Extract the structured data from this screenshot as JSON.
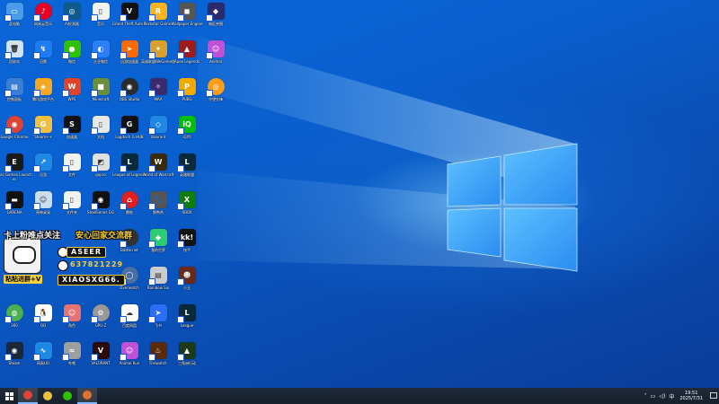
{
  "desktop": {
    "icons": [
      {
        "label": "此电脑",
        "bg": "#4a9bea",
        "glyph": "▭",
        "col": 0,
        "row": 0
      },
      {
        "label": "网易云音乐",
        "bg": "#e60026",
        "glyph": "♪",
        "col": 1,
        "row": 0,
        "round": true
      },
      {
        "label": "Ai检测器",
        "bg": "#0e5a8a",
        "glyph": "◎",
        "col": 2,
        "row": 0
      },
      {
        "label": "音乐",
        "bg": "#f2f2f2",
        "glyph": "▯",
        "col": 3,
        "row": 0
      },
      {
        "label": "Grand Theft Auto V",
        "bg": "#111",
        "glyph": "V",
        "col": 4,
        "row": 0
      },
      {
        "label": "Rockstar Games",
        "bg": "#f9b31c",
        "glyph": "R",
        "col": 5,
        "row": 0
      },
      {
        "label": "Wallpaper Engine",
        "bg": "#555",
        "glyph": "◼",
        "col": 6,
        "row": 0
      },
      {
        "label": "暗区突围",
        "bg": "#2b2a6e",
        "glyph": "◆",
        "col": 7,
        "row": 0
      },
      {
        "label": "回收站",
        "bg": "#cfe3f5",
        "glyph": "🗑",
        "col": 0,
        "row": 1
      },
      {
        "label": "迅雷",
        "bg": "#1d7cf2",
        "glyph": "↯",
        "col": 1,
        "row": 1
      },
      {
        "label": "微信",
        "bg": "#2dc100",
        "glyph": "●",
        "col": 2,
        "row": 1
      },
      {
        "label": "企业微信",
        "bg": "#2d7ff9",
        "glyph": "◐",
        "col": 3,
        "row": 1
      },
      {
        "label": "迅游加速器",
        "bg": "#ff6a00",
        "glyph": "➤",
        "col": 4,
        "row": 1
      },
      {
        "label": "英雄联盟WeGame版",
        "bg": "#d9a12b",
        "glyph": "✦",
        "col": 5,
        "row": 1
      },
      {
        "label": "Apex Legends",
        "bg": "#9c1c1c",
        "glyph": "▲",
        "col": 6,
        "row": 1
      },
      {
        "label": "Animal",
        "bg": "#c050d8",
        "glyph": "☺",
        "col": 7,
        "row": 1
      },
      {
        "label": "控制面板",
        "bg": "#3a7fd5",
        "glyph": "▤",
        "col": 0,
        "row": 2
      },
      {
        "label": "腾讯游戏平台",
        "bg": "#f5a623",
        "glyph": "◈",
        "col": 1,
        "row": 2
      },
      {
        "label": "WPS",
        "bg": "#e0452b",
        "glyph": "W",
        "col": 2,
        "row": 2
      },
      {
        "label": "Minecraft",
        "bg": "#6b8e3b",
        "glyph": "■",
        "col": 3,
        "row": 2
      },
      {
        "label": "OBS Studio",
        "bg": "#2b2b2b",
        "glyph": "◉",
        "col": 4,
        "row": 2,
        "round": true
      },
      {
        "label": "MAA",
        "bg": "#3a2b6e",
        "glyph": "✧",
        "col": 5,
        "row": 2
      },
      {
        "label": "PUBG",
        "bg": "#f2a900",
        "glyph": "P",
        "col": 6,
        "row": 2
      },
      {
        "label": "守望先锋",
        "bg": "#f99e1a",
        "glyph": "◎",
        "col": 7,
        "row": 2,
        "round": true
      },
      {
        "label": "Google Chrome",
        "bg": "#db4437",
        "glyph": "◉",
        "col": 0,
        "row": 3,
        "round": true
      },
      {
        "label": "Steam++",
        "bg": "#f0c040",
        "glyph": "G",
        "col": 1,
        "row": 3
      },
      {
        "label": "加速器",
        "bg": "#111",
        "glyph": "S",
        "col": 2,
        "row": 3
      },
      {
        "label": "文档",
        "bg": "#e8e8e8",
        "glyph": "▯",
        "col": 3,
        "row": 3
      },
      {
        "label": "Logitech G HUB",
        "bg": "#111",
        "glyph": "G",
        "col": 4,
        "row": 3
      },
      {
        "label": "Valorant",
        "bg": "#1e88e5",
        "glyph": "◇",
        "col": 5,
        "row": 3
      },
      {
        "label": "iQIYI",
        "bg": "#00be06",
        "glyph": "iQ",
        "col": 6,
        "row": 3
      },
      {
        "label": "Epic Games Launcher",
        "bg": "#1a1a1a",
        "glyph": "E",
        "col": 0,
        "row": 4
      },
      {
        "label": "迅游",
        "bg": "#1e88e5",
        "glyph": "↗",
        "col": 1,
        "row": 4
      },
      {
        "label": "文件",
        "bg": "#f2f2f2",
        "glyph": "▯",
        "col": 2,
        "row": 4
      },
      {
        "label": "gopro",
        "bg": "#e0e0e0",
        "glyph": "◩",
        "col": 3,
        "row": 4
      },
      {
        "label": "League of Legends",
        "bg": "#0a2a3a",
        "glyph": "L",
        "col": 4,
        "row": 4
      },
      {
        "label": "World of Warcraft",
        "bg": "#3a2a0a",
        "glyph": "W",
        "col": 5,
        "row": 4
      },
      {
        "label": "英雄联盟",
        "bg": "#0a2a3a",
        "glyph": "L",
        "col": 6,
        "row": 4
      },
      {
        "label": "GARENA",
        "bg": "#111",
        "glyph": "▬",
        "col": 0,
        "row": 5
      },
      {
        "label": "原神桌宠",
        "bg": "#cde",
        "glyph": "☺",
        "col": 1,
        "row": 5
      },
      {
        "label": "文件夹",
        "bg": "#f2f2f2",
        "glyph": "▯",
        "col": 2,
        "row": 5
      },
      {
        "label": "SteelSeries GG",
        "bg": "#111",
        "glyph": "◉",
        "col": 3,
        "row": 5
      },
      {
        "label": "雷蛇",
        "bg": "#e02020",
        "glyph": "⌂",
        "col": 4,
        "row": 5,
        "round": true
      },
      {
        "label": "鹅鸭杀",
        "bg": "#555",
        "glyph": "🐾",
        "col": 5,
        "row": 5
      },
      {
        "label": "XBOX",
        "bg": "#107c10",
        "glyph": "X",
        "col": 6,
        "row": 5
      },
      {
        "label": "",
        "bg": "#888",
        "glyph": "",
        "col": 0,
        "row": 6,
        "hidden": true
      },
      {
        "label": "",
        "bg": "#888",
        "glyph": "",
        "col": 1,
        "row": 6,
        "hidden": true
      },
      {
        "label": "",
        "bg": "#888",
        "glyph": "",
        "col": 2,
        "row": 6,
        "hidden": true
      },
      {
        "label": "",
        "bg": "#888",
        "glyph": "",
        "col": 3,
        "row": 6,
        "hidden": true
      },
      {
        "label": "Battle.net",
        "bg": "#333",
        "glyph": "⚙",
        "col": 4,
        "row": 6,
        "round": true
      },
      {
        "label": "我的世界",
        "bg": "#2ecc71",
        "glyph": "◆",
        "col": 5,
        "row": 6
      },
      {
        "label": "快手",
        "bg": "#111",
        "glyph": "kk!",
        "col": 6,
        "row": 6
      },
      {
        "label": "",
        "bg": "#888",
        "glyph": "",
        "col": 0,
        "row": 7,
        "hidden": true
      },
      {
        "label": "",
        "bg": "#888",
        "glyph": "",
        "col": 1,
        "row": 7,
        "hidden": true
      },
      {
        "label": "",
        "bg": "#888",
        "glyph": "",
        "col": 2,
        "row": 7,
        "hidden": true
      },
      {
        "label": "",
        "bg": "#888",
        "glyph": "",
        "col": 3,
        "row": 7,
        "hidden": true
      },
      {
        "label": "Overwatch",
        "bg": "#4a6fa5",
        "glyph": "◯",
        "col": 4,
        "row": 7,
        "round": true
      },
      {
        "label": "Rainbow Six",
        "bg": "#ccc",
        "glyph": "▤",
        "col": 5,
        "row": 7
      },
      {
        "label": "小丑",
        "bg": "#6a2a1a",
        "glyph": "☻",
        "col": 6,
        "row": 7
      },
      {
        "label": "360",
        "bg": "#4caf50",
        "glyph": "◍",
        "col": 0,
        "row": 8,
        "round": true
      },
      {
        "label": "QQ",
        "bg": "#fff",
        "glyph": "🐧",
        "col": 1,
        "row": 8
      },
      {
        "label": "角色",
        "bg": "#e57373",
        "glyph": "☺",
        "col": 2,
        "row": 8
      },
      {
        "label": "GPU-Z",
        "bg": "#999",
        "glyph": "⚙",
        "col": 3,
        "row": 8,
        "round": true
      },
      {
        "label": "百度网盘",
        "bg": "#fff",
        "glyph": "☁",
        "col": 4,
        "row": 8
      },
      {
        "label": "飞书",
        "bg": "#2b6ef5",
        "glyph": "➤",
        "col": 5,
        "row": 8
      },
      {
        "label": "League",
        "bg": "#0a2a3a",
        "glyph": "L",
        "col": 6,
        "row": 8
      },
      {
        "label": "Steam",
        "bg": "#1b2838",
        "glyph": "◉",
        "col": 0,
        "row": 9
      },
      {
        "label": "网易UU",
        "bg": "#1e88e5",
        "glyph": "∿",
        "col": 1,
        "row": 9
      },
      {
        "label": "哔哩",
        "bg": "#9e9e9e",
        "glyph": "≈",
        "col": 2,
        "row": 9
      },
      {
        "label": "VALORANT",
        "bg": "#2b0a0a",
        "glyph": "V",
        "col": 3,
        "row": 9
      },
      {
        "label": "Animal Run",
        "bg": "#c050d8",
        "glyph": "☺",
        "col": 4,
        "row": 9
      },
      {
        "label": "Firewatch",
        "bg": "#5a2a0a",
        "glyph": "♨",
        "col": 5,
        "row": 9
      },
      {
        "label": "三角洲行动",
        "bg": "#1a3a1a",
        "glyph": "▲",
        "col": 6,
        "row": 9
      }
    ]
  },
  "promo": {
    "line1": "卡上粉唯点关注",
    "line2": "安心回家交流群",
    "id1": "ASEER",
    "id2": "637821229",
    "tag": "粘粘进群+V",
    "id3": "XIAOSXG66."
  },
  "taskbar": {
    "apps": [
      {
        "name": "chrome-taskbar-icon",
        "color": "#db4437",
        "active": true
      },
      {
        "name": "steam-plus-taskbar-icon",
        "color": "#f0c040",
        "active": false
      },
      {
        "name": "wechat-taskbar-icon",
        "color": "#2dc100",
        "active": false
      },
      {
        "name": "game-taskbar-icon",
        "color": "#e07030",
        "active": true
      }
    ],
    "tray": {
      "ime": "中",
      "time": "19:51",
      "date": "2025/7/31"
    }
  }
}
